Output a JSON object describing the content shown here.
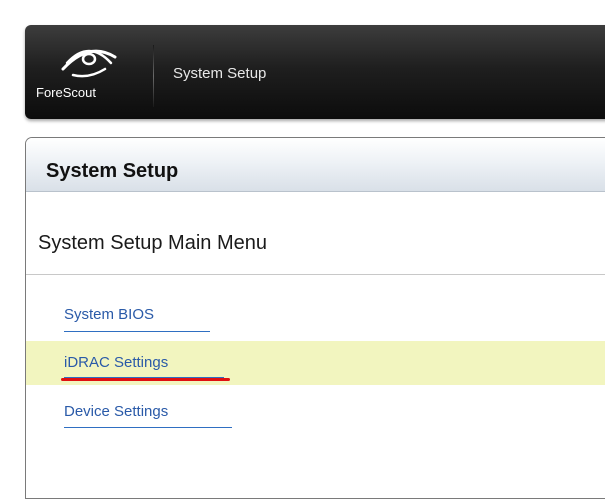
{
  "header": {
    "logo_text": "ForeScout",
    "title": "System Setup"
  },
  "panel": {
    "title": "System Setup",
    "menu_title": "System Setup Main Menu",
    "links": [
      {
        "label": "System BIOS",
        "highlighted": false
      },
      {
        "label": "iDRAC Settings",
        "highlighted": true
      },
      {
        "label": "Device Settings",
        "highlighted": false
      }
    ]
  },
  "colors": {
    "highlight": "#f2f5bf",
    "link": "#2a5aa8",
    "annotation_underline": "#e01010"
  },
  "icons": {
    "logo": "forescout-eye-logo-icon"
  }
}
